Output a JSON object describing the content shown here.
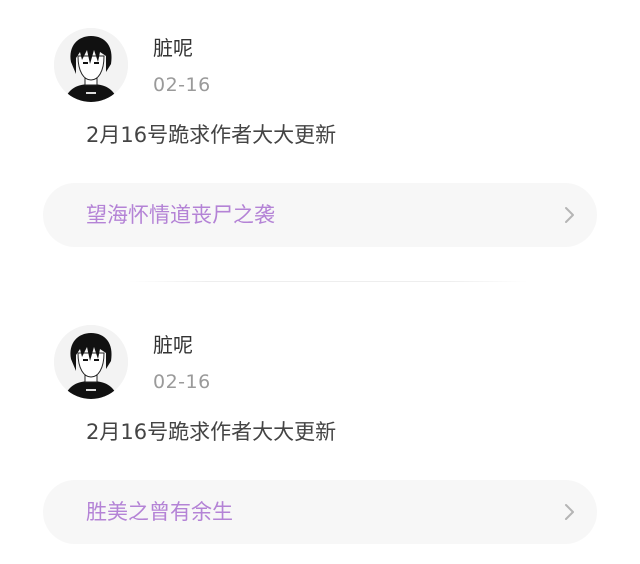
{
  "posts": [
    {
      "username": "脏呢",
      "date": "02-16",
      "comment": "2月16号跪求作者大大更新",
      "book_title": "望海怀情道丧尸之袭"
    },
    {
      "username": "脏呢",
      "date": "02-16",
      "comment": "2月16号跪求作者大大更新",
      "book_title": "胜美之曾有余生"
    }
  ],
  "icons": {
    "avatar": "anime-avatar",
    "chevron": "chevron-right-icon"
  },
  "colors": {
    "book_title": "#b483d6",
    "card_background": "#f7f7f7",
    "date_text": "#9a9a9a"
  }
}
